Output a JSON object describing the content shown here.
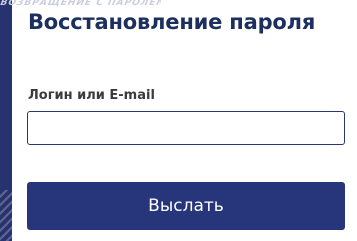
{
  "decor": {
    "top_text": "ВОЗВРАЩЕНИЕ С ПАРОЛЕМ"
  },
  "form": {
    "title": "Восстановление пароля",
    "login_label": "Логин или E-mail",
    "login_value": "",
    "login_placeholder": "",
    "submit_label": "Выслать"
  },
  "colors": {
    "title": "#1c2f5e",
    "button_bg": "#27357a",
    "input_border": "#28376e",
    "left_stripe": "#26336f"
  }
}
